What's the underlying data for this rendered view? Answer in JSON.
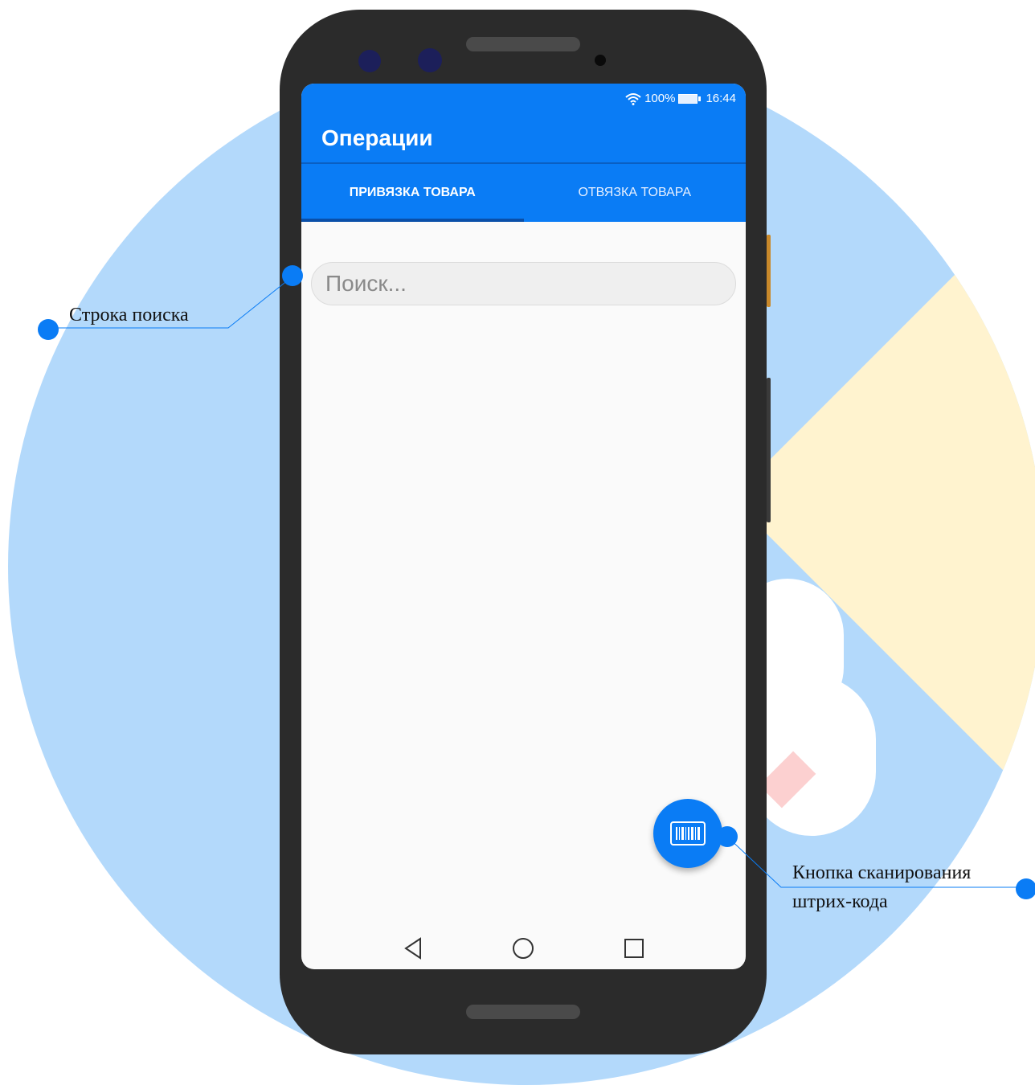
{
  "status_bar": {
    "battery_percent": "100%",
    "time": "16:44"
  },
  "app_bar": {
    "title": "Операции"
  },
  "tabs": [
    {
      "label": "ПРИВЯЗКА ТОВАРА",
      "selected": true
    },
    {
      "label": "ОТВЯЗКА ТОВАРА",
      "selected": false
    }
  ],
  "search": {
    "placeholder": "Поиск..."
  },
  "fab": {
    "icon": "barcode-icon"
  },
  "navigation": {
    "back_icon": "back-triangle-icon",
    "home_icon": "home-circle-icon",
    "recents_icon": "recents-square-icon"
  },
  "annotations": {
    "search_label": "Строка поиска",
    "scan_label_line1": "Кнопка сканирования",
    "scan_label_line2": "штрих-кода"
  },
  "colors": {
    "accent": "#0a7cf5",
    "background_circle": "#b3d9fb"
  }
}
